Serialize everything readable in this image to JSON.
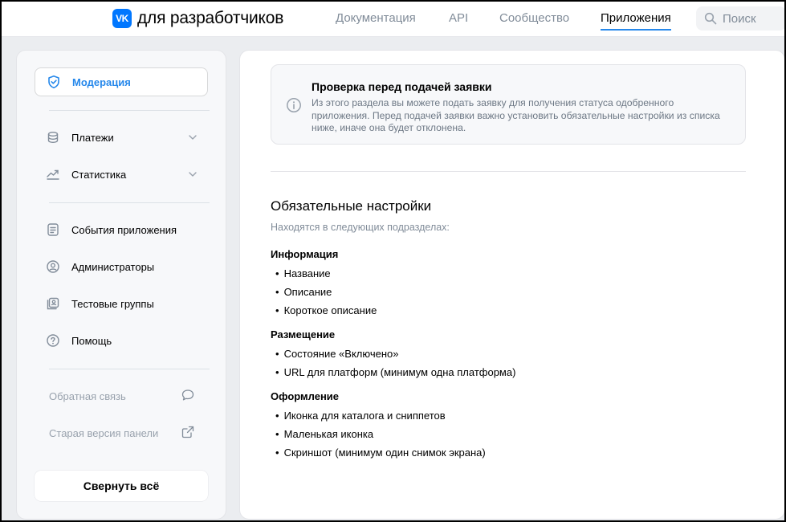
{
  "header": {
    "logo_mark": "VK",
    "logo_text": "для разработчиков",
    "nav": [
      {
        "label": "Документация",
        "active": false
      },
      {
        "label": "API",
        "active": false
      },
      {
        "label": "Сообщество",
        "active": false
      },
      {
        "label": "Приложения",
        "active": true
      }
    ],
    "search_placeholder": "Поиск"
  },
  "sidebar": {
    "items": [
      {
        "label": "Модерация",
        "icon": "shield-check-icon",
        "active": true
      },
      {
        "label": "Платежи",
        "icon": "coins-icon",
        "expandable": true
      },
      {
        "label": "Статистика",
        "icon": "stats-icon",
        "expandable": true
      },
      {
        "label": "События приложения",
        "icon": "document-list-icon"
      },
      {
        "label": "Администраторы",
        "icon": "user-circle-icon"
      },
      {
        "label": "Тестовые группы",
        "icon": "users-square-icon"
      },
      {
        "label": "Помощь",
        "icon": "help-icon"
      }
    ],
    "footer_links": [
      {
        "label": "Обратная связь",
        "icon": "message-icon"
      },
      {
        "label": "Старая версия панели",
        "icon": "external-link-icon"
      }
    ],
    "collapse_label": "Свернуть всё"
  },
  "main": {
    "info": {
      "title": "Проверка перед подачей заявки",
      "text": "Из этого раздела вы можете подать заявку для получения статуса одобренного приложения. Перед подачей заявки важно установить обязательные настройки из списка ниже, иначе она будет отклонена."
    },
    "section_title": "Обязательные настройки",
    "section_subtitle": "Находятся в следующих подразделах:",
    "groups": [
      {
        "title": "Информация",
        "items": [
          "Название",
          "Описание",
          "Короткое описание"
        ]
      },
      {
        "title": "Размещение",
        "items": [
          "Состояние «Включено»",
          "URL для платформ (минимум одна платформа)"
        ]
      },
      {
        "title": "Оформление",
        "items": [
          "Иконка для каталога и сниппетов",
          "Маленькая иконка",
          "Скриншот (минимум один снимок экрана)"
        ]
      }
    ]
  },
  "colors": {
    "accent": "#2688eb",
    "brand": "#0077ff",
    "muted_text": "#818c99"
  }
}
